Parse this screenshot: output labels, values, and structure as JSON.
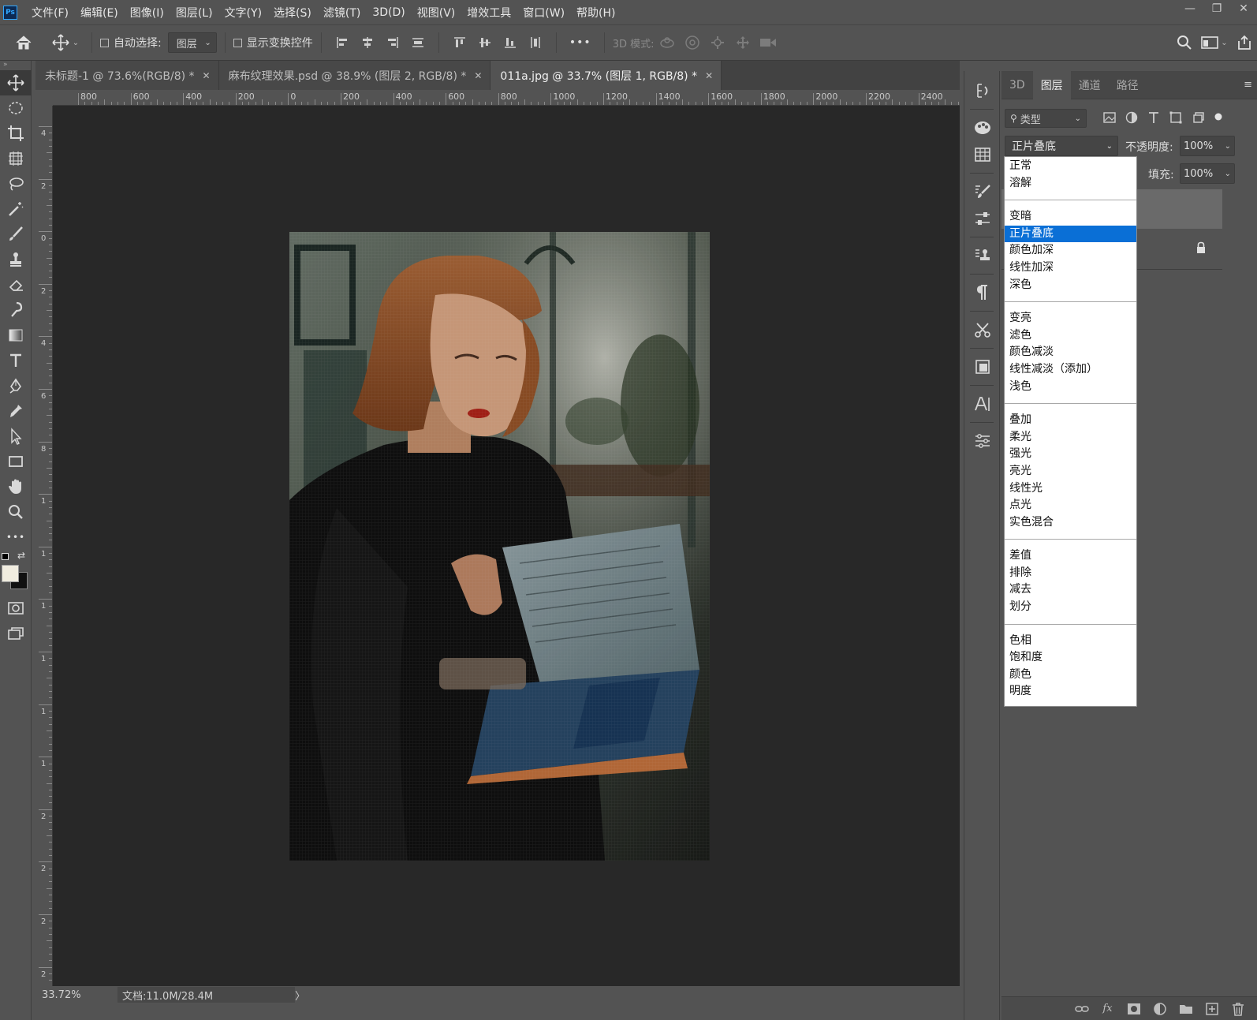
{
  "app": {
    "logo": "Ps"
  },
  "menu": [
    "文件(F)",
    "编辑(E)",
    "图像(I)",
    "图层(L)",
    "文字(Y)",
    "选择(S)",
    "滤镜(T)",
    "3D(D)",
    "视图(V)",
    "增效工具",
    "窗口(W)",
    "帮助(H)"
  ],
  "window_controls": {
    "minimize": "—",
    "restore": "❐",
    "close": "✕"
  },
  "options": {
    "auto_select_label": "自动选择:",
    "auto_select_value": "图层",
    "show_transform_label": "显示变换控件",
    "more_label": "•••",
    "mode_3d_label": "3D 模式:"
  },
  "tabs": [
    {
      "label": "未标题-1 @ 73.6%(RGB/8) *",
      "close": "✕"
    },
    {
      "label": "麻布纹理效果.psd @ 38.9% (图层 2, RGB/8) *",
      "close": "✕"
    },
    {
      "label": "011a.jpg @ 33.7% (图层 1, RGB/8) *",
      "close": "✕"
    }
  ],
  "ruler_h": [
    "800",
    "600",
    "400",
    "200",
    "0",
    "200",
    "400",
    "600",
    "800",
    "1000",
    "1200",
    "1400",
    "1600",
    "1800",
    "2000",
    "2200",
    "2400"
  ],
  "ruler_v": [
    "4",
    "2",
    "0",
    "2",
    "4",
    "6",
    "8",
    "1",
    "1",
    "1",
    "1",
    "1",
    "1",
    "2",
    "2",
    "2",
    "2"
  ],
  "status": {
    "zoom": "33.72%",
    "doc": "文档:11.0M/28.4M",
    "arrow": "〉"
  },
  "layers_panel": {
    "tabs": [
      "3D",
      "图层",
      "通道",
      "路径"
    ],
    "active_tab": "图层",
    "filter_label": "类型",
    "blend_mode": "正片叠底",
    "opacity_label": "不透明度:",
    "opacity_value": "100%",
    "fill_label": "填充:",
    "fill_value": "100%",
    "footer_fx": "fx"
  },
  "blend_dropdown": {
    "groups": [
      [
        "正常",
        "溶解"
      ],
      [
        "变暗",
        "正片叠底",
        "颜色加深",
        "线性加深",
        "深色"
      ],
      [
        "变亮",
        "滤色",
        "颜色减淡",
        "线性减淡（添加）",
        "浅色"
      ],
      [
        "叠加",
        "柔光",
        "强光",
        "亮光",
        "线性光",
        "点光",
        "实色混合"
      ],
      [
        "差值",
        "排除",
        "减去",
        "划分"
      ],
      [
        "色相",
        "饱和度",
        "颜色",
        "明度"
      ]
    ],
    "selected": "正片叠底"
  },
  "icons": {
    "tools": [
      "move-icon",
      "ellipse-marquee-icon",
      "crop-icon",
      "frame-icon",
      "lasso-icon",
      "magic-wand-icon",
      "brush-icon",
      "stamp-icon",
      "eraser-icon",
      "smudge-icon",
      "gradient-icon",
      "type-icon",
      "pen-icon",
      "eyedropper-icon",
      "path-select-icon",
      "rectangle-icon",
      "hand-icon",
      "zoom-icon",
      "more-tools-icon"
    ],
    "panel_strip": [
      "history-icon",
      "color-palette-icon",
      "swatches-icon",
      "brush-settings-icon",
      "tool-presets-icon",
      "clone-source-icon",
      "paragraph-icon",
      "tools-scissor-icon",
      "artboard-icon",
      "character-icon",
      "adjustments-icon"
    ]
  },
  "colors": {
    "selection_blue": "#0a6fd6",
    "ps_blue": "#31a8ff",
    "canvas_bg": "#282828",
    "ui_bg": "#535353"
  }
}
